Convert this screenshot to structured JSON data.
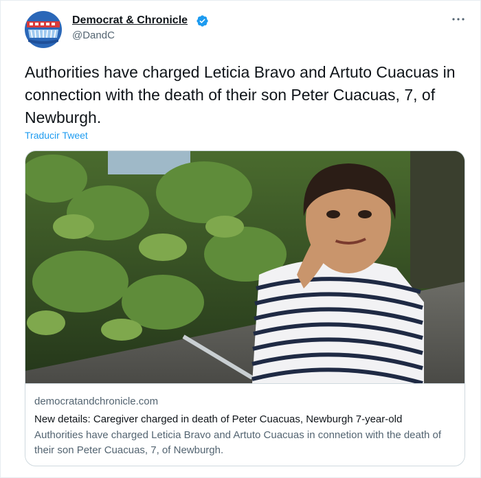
{
  "author": {
    "name": "Democrat & Chronicle",
    "handle": "@DandC",
    "verified": true
  },
  "tweet": {
    "text": "Authorities have charged Leticia Bravo and Artuto Cuacuas in connection with the death of their son Peter Cuacuas, 7, of Newburgh.",
    "translate_label": "Traducir Tweet"
  },
  "card": {
    "domain": "democratandchronicle.com",
    "title": "New details: Caregiver charged in death of Peter Cuacuas, Newburgh 7-year-old",
    "description": "Authorities have charged Leticia Bravo and Artuto Cuacuas in connetion with the death of their son Peter Cuacuas, 7, of Newburgh."
  },
  "icons": {
    "more": "more-options-icon",
    "verified": "verified-badge-icon"
  },
  "colors": {
    "link": "#1d9bf0",
    "secondary_text": "#536471",
    "verified": "#1d9bf0"
  }
}
